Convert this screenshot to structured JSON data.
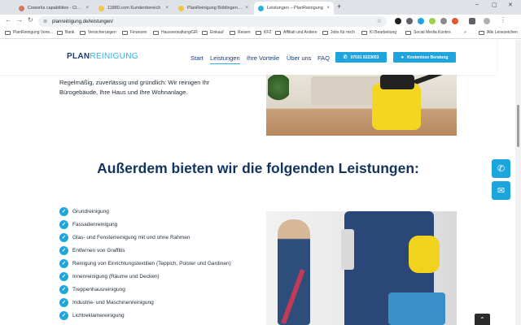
{
  "browser": {
    "tabs": [
      {
        "title": "Coworks capabilities - Claude",
        "color": "#d97757"
      },
      {
        "title": "11880.com Kundenbereich",
        "color": "#f4c542"
      },
      {
        "title": "PlanReinigung Böblingen | Au...",
        "color": "#f4c542"
      },
      {
        "title": "Leistungen – PlanReinigung",
        "color": "#2eb0e6"
      }
    ],
    "url": "planreinigung.de/leistungen/",
    "bookmarks": [
      "PlanReinigung Verw...",
      "Bank",
      "Versicherungen",
      "Finanzen",
      "Hausverwaltung/GR",
      "Einkauf",
      "Reisen",
      "KFZ",
      "Affiliati und Andere",
      "Jobs für mich",
      "KI Bearbeitung",
      "Social Media Kontex"
    ],
    "bookmarks_more": "»",
    "other_bookmarks": "Alle Lesezeichen"
  },
  "site": {
    "logo_plan": "PLAN",
    "logo_reinigung": "REINIGUNG",
    "nav": [
      "Start",
      "Leistungen",
      "Ihre Vorteile",
      "Über uns",
      "FAQ"
    ],
    "phone_button": "07031 9223053",
    "consult_button": "Kostenlose Beratung"
  },
  "content": {
    "intro": "Regelmäßig, zuverlässig und gründlich: Wir reinigen Ihr Bürogebäude, Ihre Haus und Ihre Wohnanlage.",
    "section_title": "Außerdem bieten wir die folgenden Leistungen:",
    "services": [
      "Grundreinigung",
      "Fassadenreinigung",
      "Glas- und Fensterreinigung mit und ohne Rahmen",
      "Entfernen von Graffitis",
      "Reinigung von Einrichtungstextilien (Teppich, Polster und Gardinen)",
      "Innenreinigung (Räume und Decken)",
      "Treppenhausreinigung",
      "Industrie- und Maschinenreinigung",
      "Lichtreklamereinigung"
    ]
  },
  "icons": {
    "check": "✓",
    "phone": "✆",
    "mail": "✉",
    "arrow_up": "⌃"
  },
  "colors": {
    "brand_dark": "#1a3c6e",
    "brand_accent": "#1fa5dd"
  }
}
